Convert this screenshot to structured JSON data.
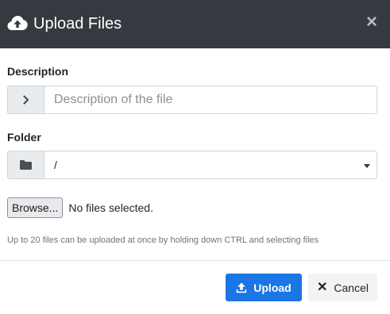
{
  "header": {
    "title": "Upload Files",
    "icon": "cloud-upload-icon",
    "close_symbol": "×",
    "background": "#343a40"
  },
  "description": {
    "label": "Description",
    "placeholder": "Description of the file",
    "value": "",
    "addon_icon": "chevron-right-icon"
  },
  "folder": {
    "label": "Folder",
    "selected": "/",
    "addon_icon": "folder-icon"
  },
  "file_input": {
    "browse_label": "Browse...",
    "status": "No files selected."
  },
  "help_text": "Up to 20 files can be uploaded at once by holding down CTRL and selecting files",
  "footer": {
    "upload_label": "Upload",
    "upload_icon": "upload-icon",
    "cancel_label": "Cancel",
    "cancel_symbol": "✕",
    "accent": "#1976e4"
  }
}
